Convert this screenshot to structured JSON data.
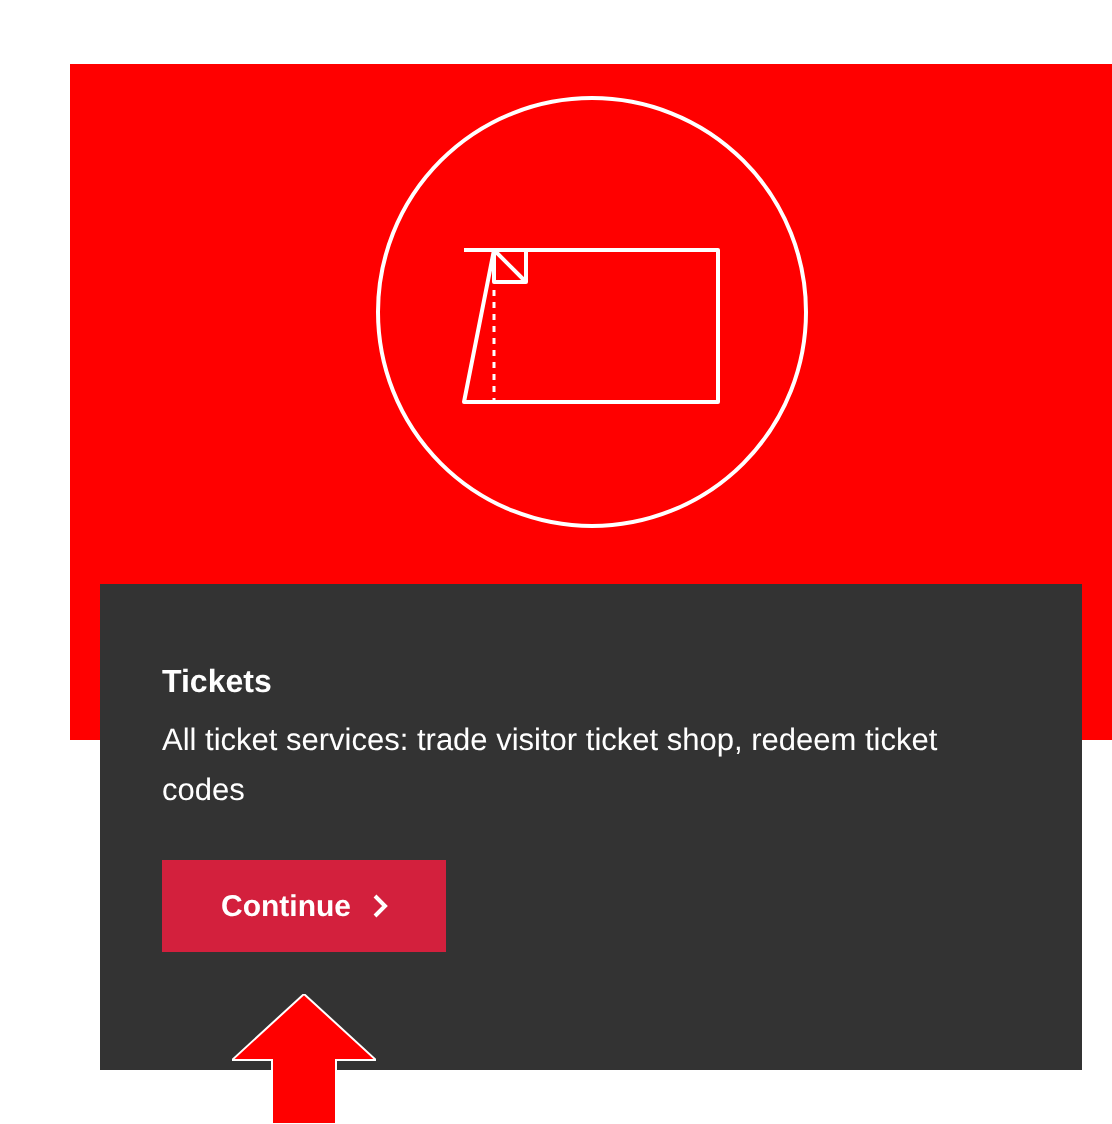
{
  "card": {
    "title": "Tickets",
    "description": "All ticket services: trade visitor ticket shop, redeem ticket codes",
    "button": "Continue"
  }
}
